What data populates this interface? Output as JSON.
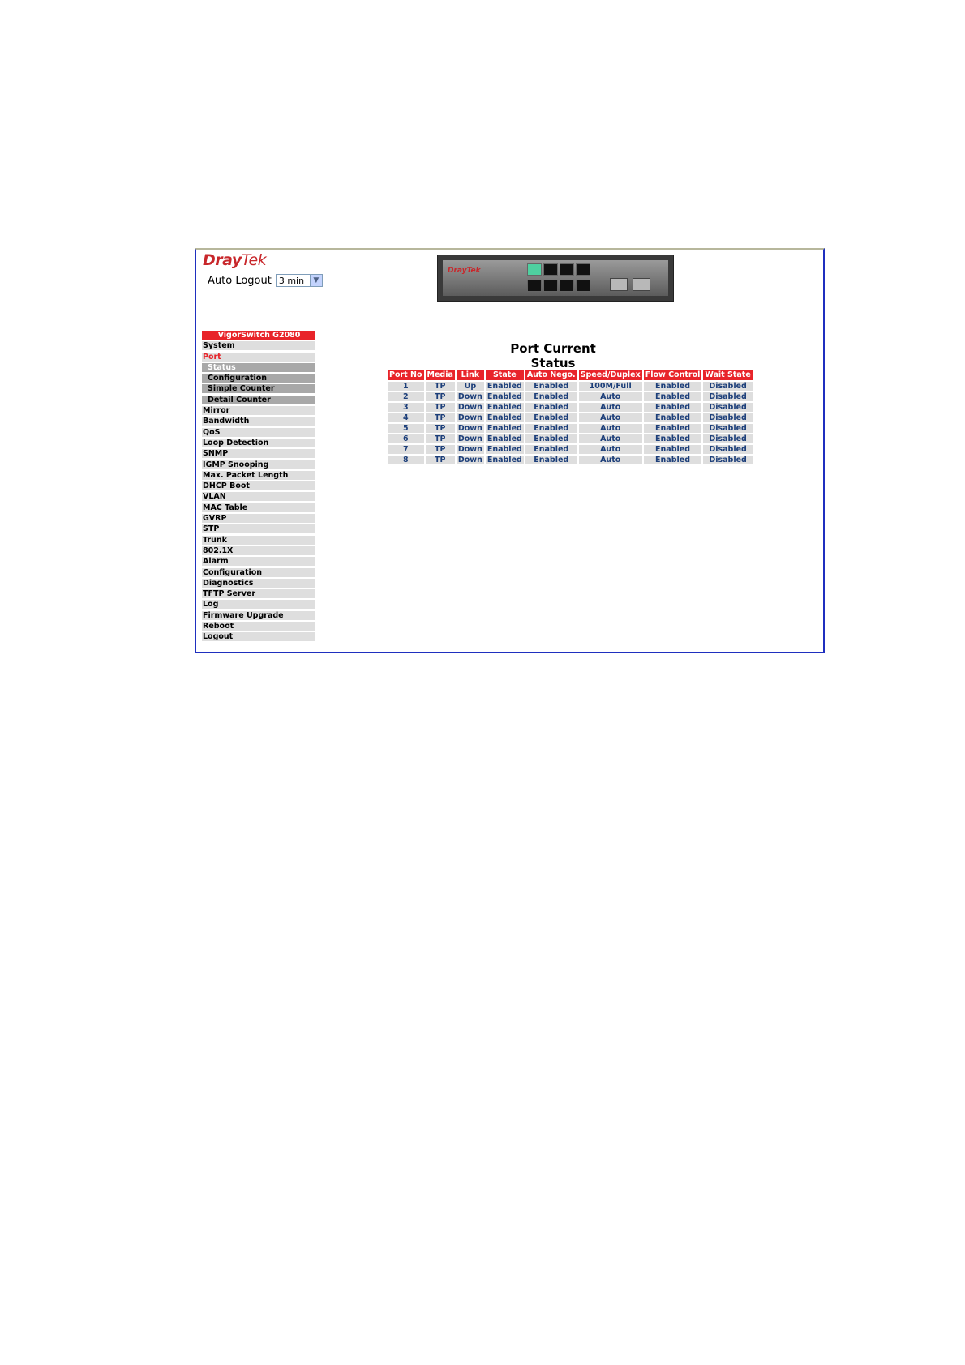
{
  "header": {
    "logo_main": "Dray",
    "logo_tek": "Tek",
    "auto_logout_label": "Auto Logout",
    "auto_logout_value": "3 min",
    "device_brand": "DrayTek"
  },
  "sidebar": {
    "title": "VigorSwitch G2080",
    "items": [
      {
        "label": "System",
        "state": ""
      },
      {
        "label": "Port",
        "state": "active"
      },
      {
        "label": "Status",
        "state": "sub cur"
      },
      {
        "label": "Configuration",
        "state": "sub"
      },
      {
        "label": "Simple Counter",
        "state": "sub"
      },
      {
        "label": "Detail Counter",
        "state": "sub"
      },
      {
        "label": "Mirror",
        "state": ""
      },
      {
        "label": "Bandwidth",
        "state": ""
      },
      {
        "label": "QoS",
        "state": ""
      },
      {
        "label": "Loop Detection",
        "state": ""
      },
      {
        "label": "SNMP",
        "state": ""
      },
      {
        "label": "IGMP Snooping",
        "state": ""
      },
      {
        "label": "Max. Packet Length",
        "state": ""
      },
      {
        "label": "DHCP Boot",
        "state": ""
      },
      {
        "label": "VLAN",
        "state": ""
      },
      {
        "label": "MAC Table",
        "state": ""
      },
      {
        "label": "GVRP",
        "state": ""
      },
      {
        "label": "STP",
        "state": ""
      },
      {
        "label": "Trunk",
        "state": ""
      },
      {
        "label": "802.1X",
        "state": ""
      },
      {
        "label": "Alarm",
        "state": ""
      },
      {
        "label": "Configuration",
        "state": ""
      },
      {
        "label": "Diagnostics",
        "state": ""
      },
      {
        "label": "TFTP Server",
        "state": ""
      },
      {
        "label": "Log",
        "state": ""
      },
      {
        "label": "Firmware Upgrade",
        "state": ""
      },
      {
        "label": "Reboot",
        "state": ""
      },
      {
        "label": "Logout",
        "state": ""
      }
    ]
  },
  "main": {
    "title": "Port Current Status",
    "columns": [
      "Port No",
      "Media",
      "Link",
      "State",
      "Auto Nego.",
      "Speed/Duplex",
      "Flow Control",
      "Wait State"
    ],
    "rows": [
      [
        "1",
        "TP",
        "Up",
        "Enabled",
        "Enabled",
        "100M/Full",
        "Enabled",
        "Disabled"
      ],
      [
        "2",
        "TP",
        "Down",
        "Enabled",
        "Enabled",
        "Auto",
        "Enabled",
        "Disabled"
      ],
      [
        "3",
        "TP",
        "Down",
        "Enabled",
        "Enabled",
        "Auto",
        "Enabled",
        "Disabled"
      ],
      [
        "4",
        "TP",
        "Down",
        "Enabled",
        "Enabled",
        "Auto",
        "Enabled",
        "Disabled"
      ],
      [
        "5",
        "TP",
        "Down",
        "Enabled",
        "Enabled",
        "Auto",
        "Enabled",
        "Disabled"
      ],
      [
        "6",
        "TP",
        "Down",
        "Enabled",
        "Enabled",
        "Auto",
        "Enabled",
        "Disabled"
      ],
      [
        "7",
        "TP",
        "Down",
        "Enabled",
        "Enabled",
        "Auto",
        "Enabled",
        "Disabled"
      ],
      [
        "8",
        "TP",
        "Down",
        "Enabled",
        "Enabled",
        "Auto",
        "Enabled",
        "Disabled"
      ]
    ]
  },
  "colors": {
    "accent_red": "#e8242a",
    "frame_blue": "#1f2fbf",
    "cell_text": "#1d3f7a"
  }
}
